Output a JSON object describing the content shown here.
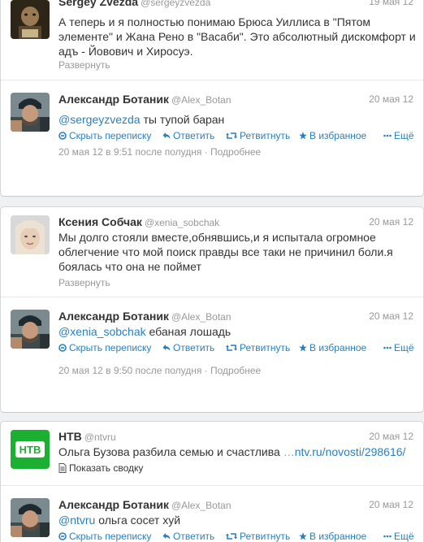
{
  "actions": {
    "hide": "Скрыть переписку",
    "reply": "Ответить",
    "retweet": "Ретвитнуть",
    "favorite": "В избранное",
    "more": "Ещё",
    "expand": "Развернуть",
    "summary": "Показать сводку"
  },
  "colors": {
    "link": "#2a7fbf",
    "muted": "#999999",
    "text": "#333333"
  },
  "c1": {
    "t1": {
      "name": "Sergey Zvezda",
      "handle": "@sergeyzvezda",
      "time": "19 мая 12",
      "text": "А теперь и я полностью понимаю Брюса Уиллиса в \"Пятом элементе\" и Жана Рено в \"Васаби\". Это абсолютный дискомфорт и адъ - Йовович и Хиросуэ."
    },
    "t2": {
      "name": "Александр Ботаник",
      "handle": "@Alex_Botan",
      "time": "20 мая 12",
      "mention": "@sergeyzvezda",
      "text": " ты тупой баран",
      "meta": "20 мая 12 в 9:51 после полудня · Подробнее"
    }
  },
  "c2": {
    "t1": {
      "name": "Ксения Собчак",
      "handle": "@xenia_sobchak",
      "time": "20 мая 12",
      "text": "Мы долго стояли вместе,обнявшись,и я испытала огромное облегчение что мой поиск правды все таки не причинил боли.я боялась что она не поймет"
    },
    "t2": {
      "name": "Александр Ботаник",
      "handle": "@Alex_Botan",
      "time": "20 мая 12",
      "mention": "@xenia_sobchak",
      "text": " ебаная лошадь",
      "meta": "20 мая 12 в 9:50 после полудня · Подробнее"
    }
  },
  "c3": {
    "t1": {
      "name": "НТВ",
      "handle": "@ntvru",
      "time": "20 мая 12",
      "text": "Ольга Бузова разбила семью и счастлива ",
      "link": "ntv.ru/novosti/298616/"
    },
    "t2": {
      "name": "Александр Ботаник",
      "handle": "@Alex_Botan",
      "time": "20 мая 12",
      "mention": "@ntvru",
      "text": " ольга сосет хуй"
    }
  }
}
